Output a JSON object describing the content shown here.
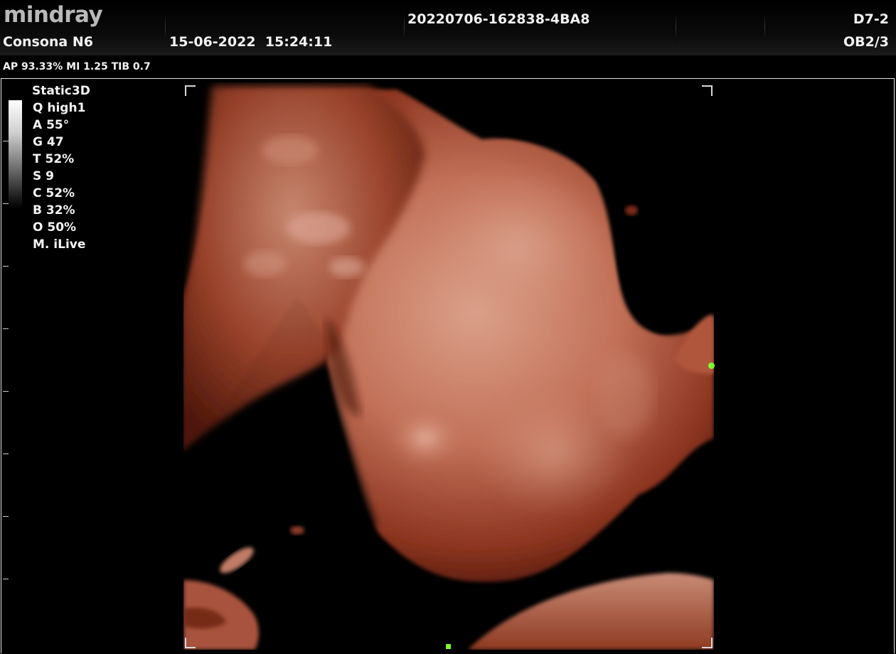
{
  "header": {
    "brand": "mindray",
    "model": "Consona N6",
    "date": "15-06-2022",
    "time": "15:24:11",
    "exam_id": "20220706-162838-4BA8",
    "probe": "D7-2",
    "preset": "OB2/3"
  },
  "acoustic": {
    "line": "AP 93.33%  MI 1.25 TIB 0.7"
  },
  "imaging_params": {
    "mode": "Static3D",
    "rows": [
      "Q high1",
      "A 55°",
      "G 47",
      "T 52%",
      "S 9",
      "C 52%",
      "B 32%",
      "O 50%",
      "M. iLive"
    ]
  },
  "colors": {
    "tissue": "#b4543a",
    "tissue_highlight": "#d99a84",
    "orientation_marker": "#7cff2a",
    "frame": "#e6e6e6"
  },
  "icons": {
    "gray_scale_bar": "grayscale-bar",
    "orientation_marker": "orientation-dot-icon"
  }
}
